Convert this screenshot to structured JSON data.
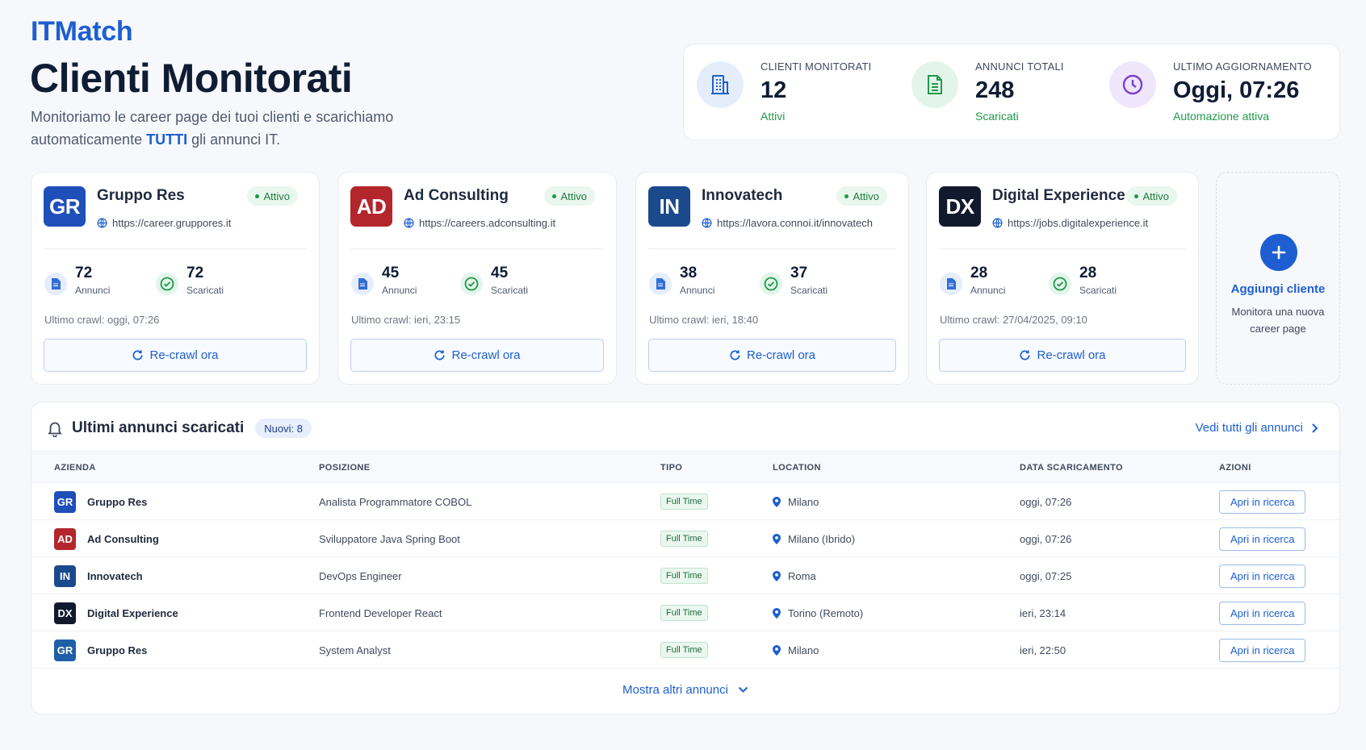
{
  "app": {
    "brand": "ITMatch",
    "title": "Clienti Monitorati",
    "subtitle_before": "Monitoriamo le career page dei tuoi clienti e scarichiamo automaticamente ",
    "subtitle_highlight": "TUTTI",
    "subtitle_after": " gli annunci IT."
  },
  "colors": {
    "accent": "#1d5fd0",
    "success": "#1f9a4b",
    "gruppo_res": "#1f4fb8",
    "ad_consulting": "#b3262c",
    "innovatech": "#1b4a8c",
    "digital_experience": "#111a2d"
  },
  "stats": [
    {
      "label": "CLIENTI MONITORATI",
      "value": "12",
      "sub": "Attivi",
      "icon": "building-icon"
    },
    {
      "label": "ANNUNCI TOTALI",
      "value": "248",
      "sub": "Scaricati",
      "icon": "document-icon"
    },
    {
      "label": "ULTIMO AGGIORNAMENTO",
      "value": "Oggi, 07:26",
      "sub": "Automazione attiva",
      "icon": "clock-icon"
    }
  ],
  "clients": [
    {
      "initials": "GR",
      "name": "Gruppo Res",
      "status": "Attivo",
      "url": "https://career.gruppores.it",
      "ads": "72",
      "ads_label": "Annunci",
      "downloaded": "72",
      "downloaded_label": "Scaricati",
      "last_crawl": "Ultimo crawl: oggi, 07:26",
      "recrawl": "Re-crawl ora"
    },
    {
      "initials": "AD",
      "name": "Ad Consulting",
      "status": "Attivo",
      "url": "https://careers.adconsulting.it",
      "ads": "45",
      "ads_label": "Annunci",
      "downloaded": "45",
      "downloaded_label": "Scaricati",
      "last_crawl": "Ultimo crawl: ieri, 23:15",
      "recrawl": "Re-crawl ora"
    },
    {
      "initials": "IN",
      "name": "Innovatech",
      "status": "Attivo",
      "url": "https://lavora.connoi.it/innovatech",
      "ads": "38",
      "ads_label": "Annunci",
      "downloaded": "37",
      "downloaded_label": "Scaricati",
      "last_crawl": "Ultimo crawl: ieri, 18:40",
      "recrawl": "Re-crawl ora"
    },
    {
      "initials": "DX",
      "name": "Digital Experience",
      "status": "Attivo",
      "url": "https://jobs.digitalexperience.it",
      "ads": "28",
      "ads_label": "Annunci",
      "downloaded": "28",
      "downloaded_label": "Scaricati",
      "last_crawl": "Ultimo crawl: 27/04/2025, 09:10",
      "recrawl": "Re-crawl ora"
    }
  ],
  "add_client": {
    "title": "Aggiungi cliente",
    "description": "Monitora una nuova career page"
  },
  "latest": {
    "title": "Ultimi annunci scaricati",
    "new_badge": "Nuovi: 8",
    "see_all": "Vedi tutti gli annunci",
    "show_more": "Mostra altri annunci",
    "columns": [
      "AZIENDA",
      "POSIZIONE",
      "TIPO",
      "LOCATION",
      "DATA SCARICAMENTO",
      "AZIONI"
    ],
    "rows": [
      {
        "initials": "GR",
        "company": "Gruppo Res",
        "position": "Analista Programmatore COBOL",
        "type": "Full Time",
        "location": "Milano",
        "date": "oggi, 07:26",
        "action": "Apri in ricerca"
      },
      {
        "initials": "AD",
        "company": "Ad Consulting",
        "position": "Sviluppatore Java Spring Boot",
        "type": "Full Time",
        "location": "Milano (Ibrido)",
        "date": "oggi, 07:26",
        "action": "Apri in ricerca"
      },
      {
        "initials": "IN",
        "company": "Innovatech",
        "position": "DevOps Engineer",
        "type": "Full Time",
        "location": "Roma",
        "date": "oggi, 07:25",
        "action": "Apri in ricerca"
      },
      {
        "initials": "DX",
        "company": "Digital Experience",
        "position": "Frontend Developer React",
        "type": "Full Time",
        "location": "Torino (Remoto)",
        "date": "ieri, 23:14",
        "action": "Apri in ricerca"
      },
      {
        "initials": "GR",
        "company": "Gruppo Res",
        "position": "System Analyst",
        "type": "Full Time",
        "location": "Milano",
        "date": "ieri, 22:50",
        "action": "Apri in ricerca"
      }
    ]
  }
}
